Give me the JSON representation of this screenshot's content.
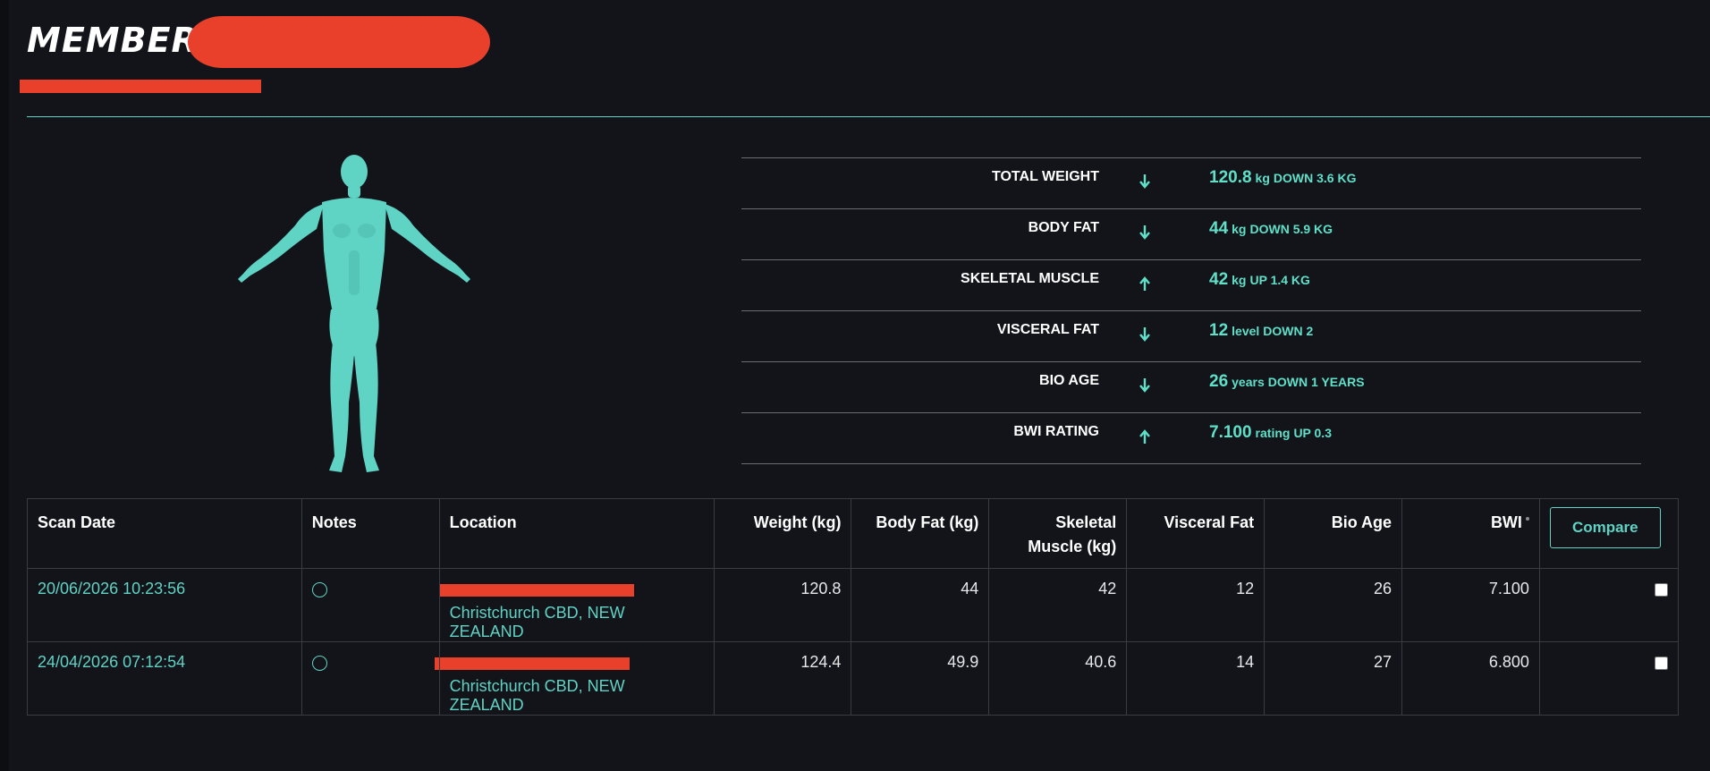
{
  "header": {
    "member_label": "MEMBER :"
  },
  "stats": [
    {
      "label": "TOTAL WEIGHT",
      "direction": "down",
      "value": "120.8",
      "unit": "kg",
      "change": "DOWN 3.6 KG"
    },
    {
      "label": "BODY FAT",
      "direction": "down",
      "value": "44",
      "unit": "kg",
      "change": "DOWN 5.9 KG"
    },
    {
      "label": "SKELETAL MUSCLE",
      "direction": "up",
      "value": "42",
      "unit": "kg",
      "change": "UP 1.4 KG"
    },
    {
      "label": "VISCERAL FAT",
      "direction": "down",
      "value": "12",
      "unit": "level",
      "change": "DOWN 2"
    },
    {
      "label": "BIO AGE",
      "direction": "down",
      "value": "26",
      "unit": "years",
      "change": "DOWN 1 YEARS"
    },
    {
      "label": "BWI RATING",
      "direction": "up",
      "value": "7.100",
      "unit": "rating",
      "change": "UP 0.3"
    }
  ],
  "table": {
    "headers": {
      "scan_date": "Scan Date",
      "notes": "Notes",
      "location": "Location",
      "weight": "Weight (kg)",
      "body_fat": "Body Fat (kg)",
      "skeletal_muscle": "Skeletal Muscle (kg)",
      "visceral_fat": "Visceral Fat",
      "bio_age": "Bio Age",
      "bwi": "BWI",
      "compare": "Compare"
    },
    "rows": [
      {
        "scan_date": "20/06/2026 10:23:56",
        "location": "Christchurch CBD, NEW ZEALAND",
        "weight": "120.8",
        "body_fat": "44",
        "skeletal_muscle": "42",
        "visceral_fat": "12",
        "bio_age": "26",
        "bwi": "7.100"
      },
      {
        "scan_date": "24/04/2026 07:12:54",
        "location": "Christchurch CBD, NEW ZEALAND",
        "weight": "124.4",
        "body_fat": "49.9",
        "skeletal_muscle": "40.6",
        "visceral_fat": "14",
        "bio_age": "27",
        "bwi": "6.800"
      }
    ]
  },
  "colors": {
    "accent": "#5fd3c4",
    "background": "#13141a",
    "redaction": "#e8402b"
  },
  "icons": {
    "up": "arrow-up-icon",
    "down": "arrow-down-icon",
    "notes": "note-circle-icon"
  }
}
